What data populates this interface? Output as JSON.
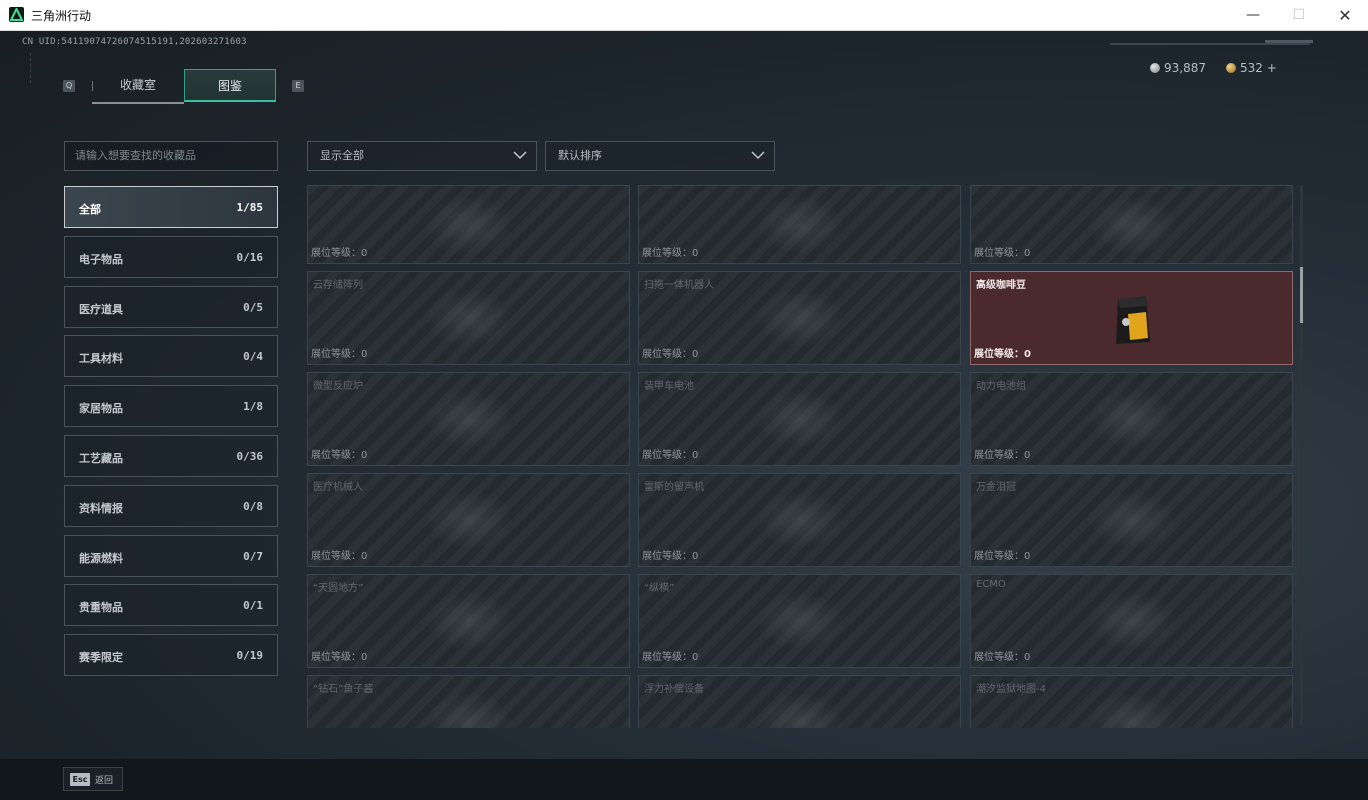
{
  "window": {
    "title": "三角洲行动",
    "min_glyph": "—",
    "max_glyph": "☐",
    "close_glyph": "✕"
  },
  "header": {
    "uid": "CN UID:54119074726074515191,202603271603",
    "key_left": "Q",
    "key_right": "E",
    "tabs": [
      {
        "label": "收藏室"
      },
      {
        "label": "图鉴"
      }
    ],
    "currency": {
      "silver": "93,887",
      "gold": "532 +"
    }
  },
  "search": {
    "placeholder": "请输入想要查找的收藏品"
  },
  "categories": [
    {
      "name": "全部",
      "count": "1/85"
    },
    {
      "name": "电子物品",
      "count": "0/16"
    },
    {
      "name": "医疗道具",
      "count": "0/5"
    },
    {
      "name": "工具材料",
      "count": "0/4"
    },
    {
      "name": "家居物品",
      "count": "1/8"
    },
    {
      "name": "工艺藏品",
      "count": "0/36"
    },
    {
      "name": "资料情报",
      "count": "0/8"
    },
    {
      "name": "能源燃料",
      "count": "0/7"
    },
    {
      "name": "贵重物品",
      "count": "0/1"
    },
    {
      "name": "赛季限定",
      "count": "0/19"
    }
  ],
  "filters": {
    "show": "显示全部",
    "sort": "默认排序"
  },
  "items": [
    {
      "name": "",
      "level": "展位等级：0"
    },
    {
      "name": "",
      "level": "展位等级：0"
    },
    {
      "name": "",
      "level": "展位等级：0"
    },
    {
      "name": "云存储阵列",
      "level": "展位等级：0"
    },
    {
      "name": "扫拖一体机器人",
      "level": "展位等级：0"
    },
    {
      "name": "高级咖啡豆",
      "level": "展位等级：0"
    },
    {
      "name": "微型反应炉",
      "level": "展位等级：0"
    },
    {
      "name": "装甲车电池",
      "level": "展位等级：0"
    },
    {
      "name": "动力电池组",
      "level": "展位等级：0"
    },
    {
      "name": "医疗机械人",
      "level": "展位等级：0"
    },
    {
      "name": "雷斯的留声机",
      "level": "展位等级：0"
    },
    {
      "name": "万金泪冠",
      "level": "展位等级：0"
    },
    {
      "name": "“天圆地方”",
      "level": "展位等级：0"
    },
    {
      "name": "“纵横”",
      "level": "展位等级：0"
    },
    {
      "name": "ECMO",
      "level": "展位等级：0"
    },
    {
      "name": "“钻石”鱼子酱",
      "level": ""
    },
    {
      "name": "浮力补偿设备",
      "level": ""
    },
    {
      "name": "潮汐监狱地图-4",
      "level": ""
    }
  ],
  "footer": {
    "esc_key": "Esc",
    "back_label": "返回"
  }
}
